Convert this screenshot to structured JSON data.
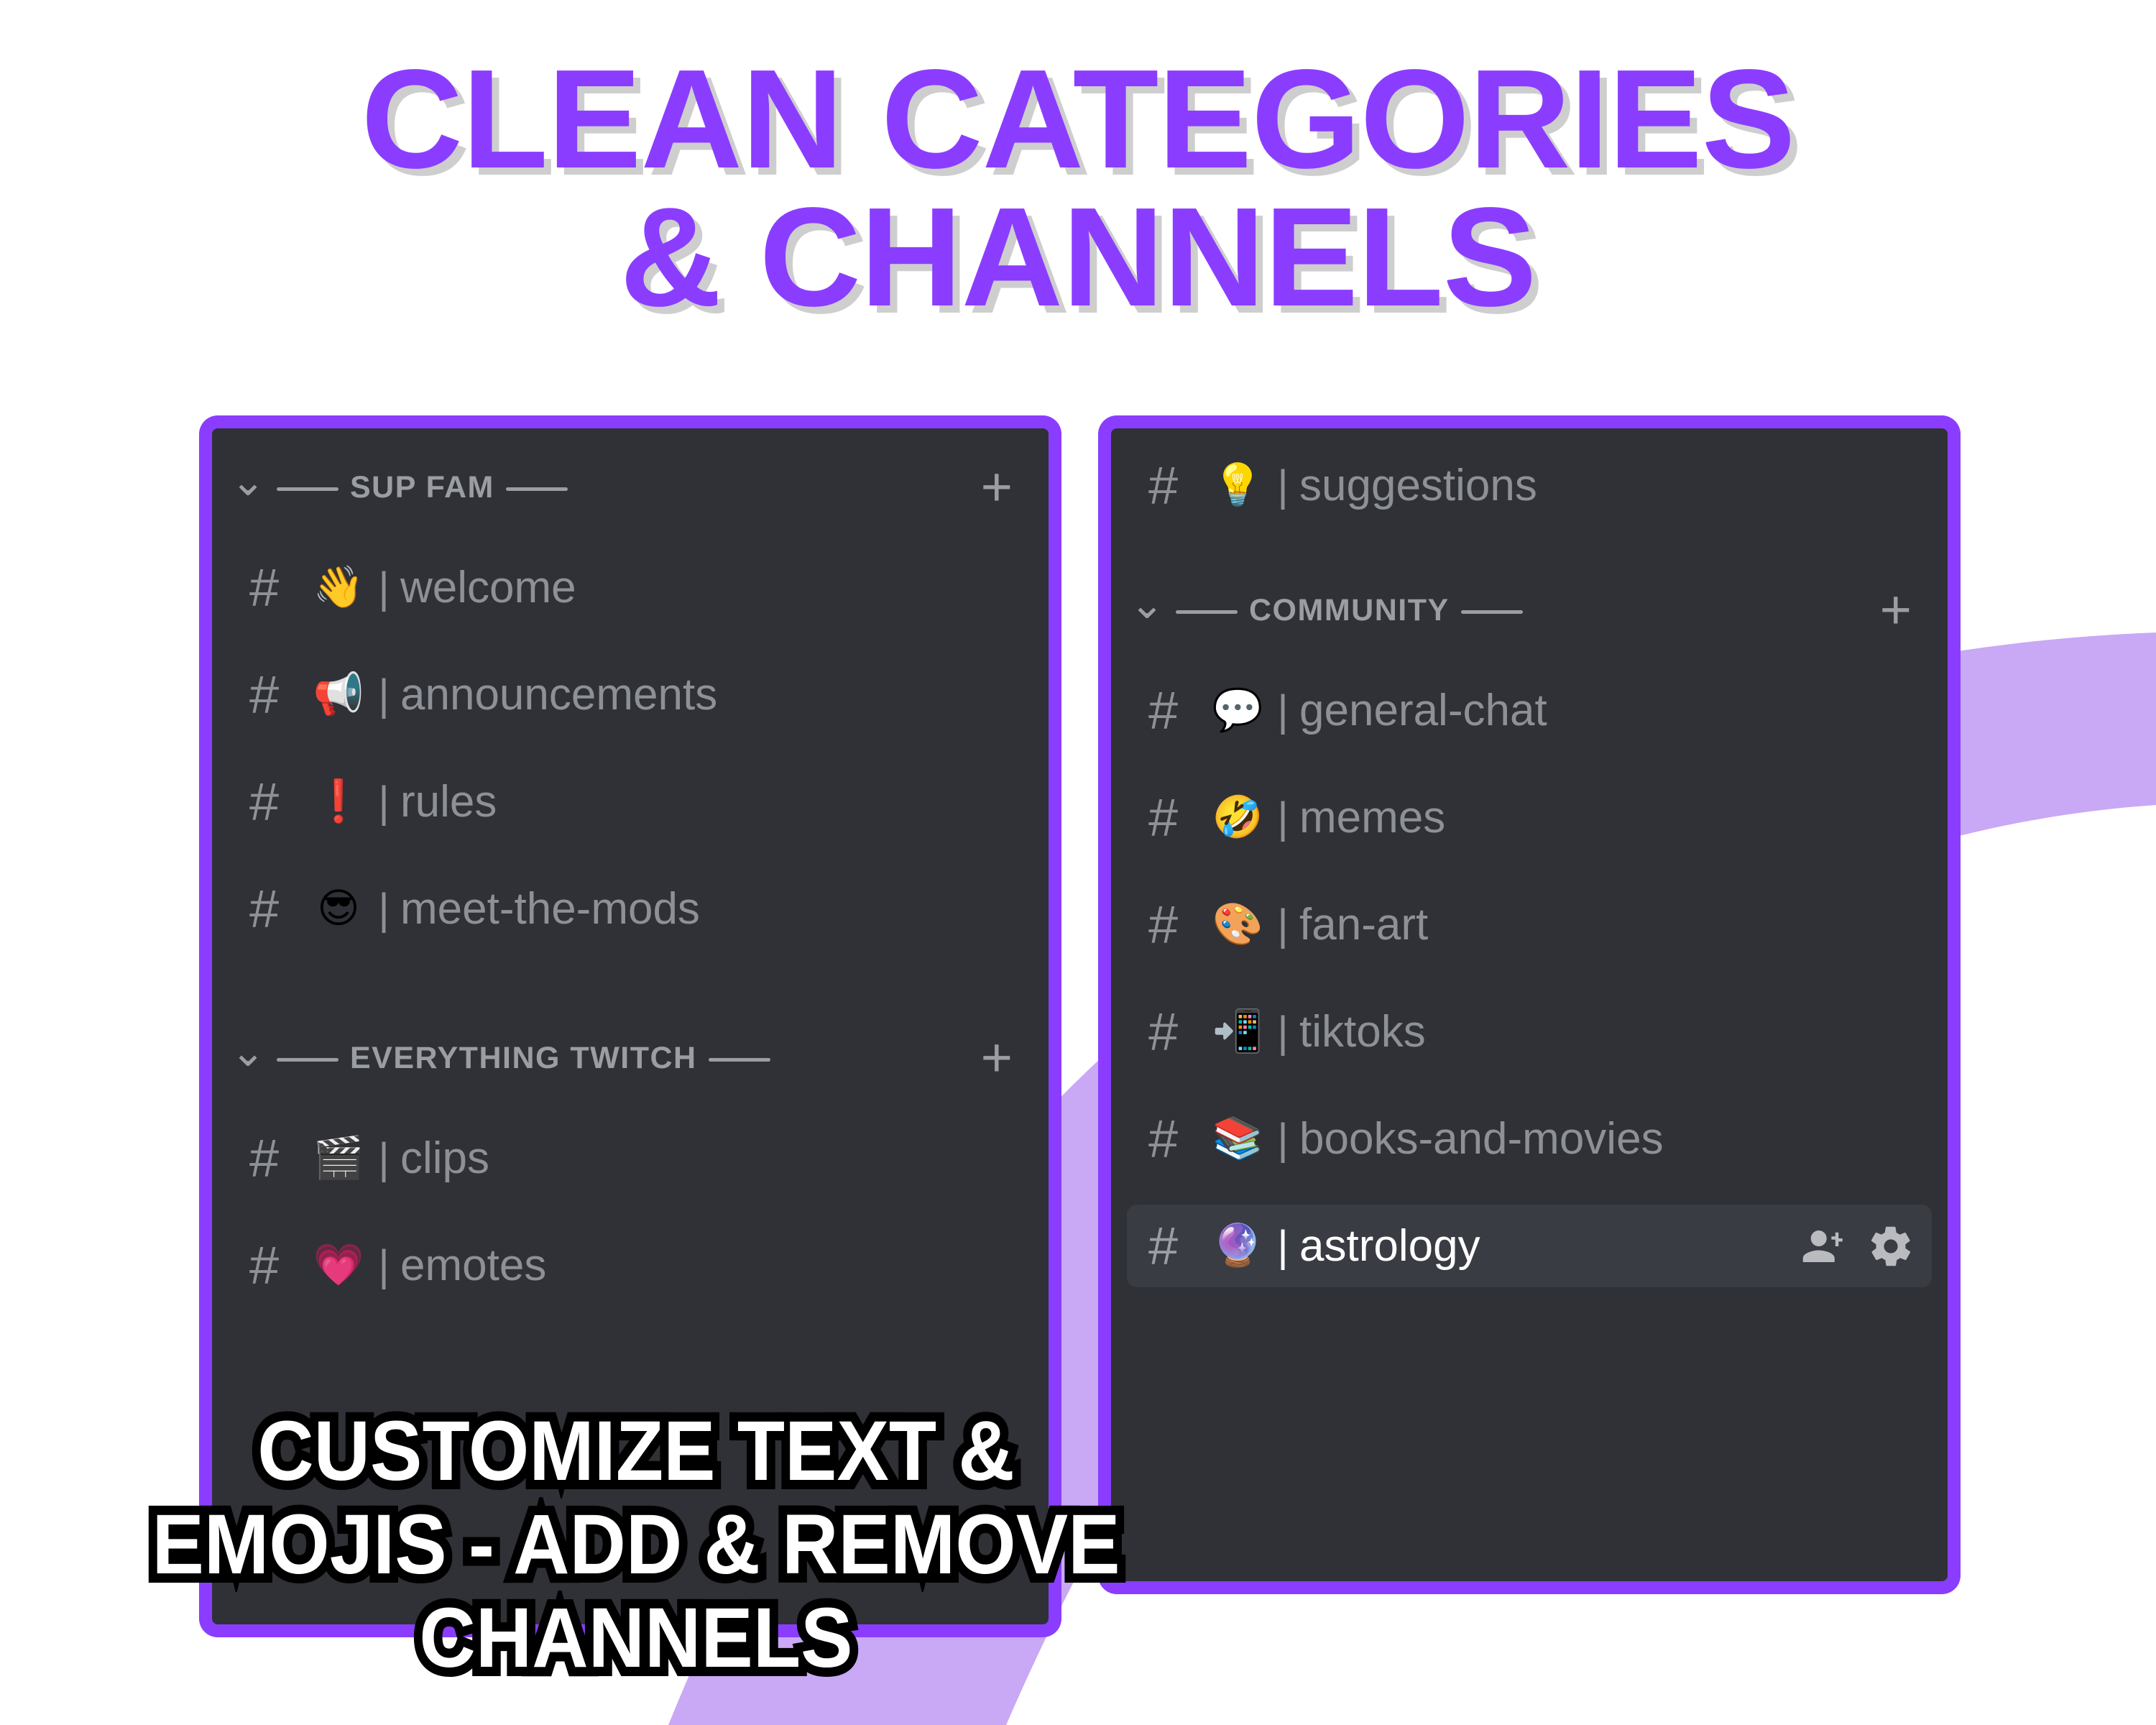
{
  "title": {
    "line1": "CLEAN CATEGORIES",
    "line2": "& CHANNELS",
    "color": "#8B3DFF",
    "shadow_color": "#BEBEBE"
  },
  "theme": {
    "page_background": "#FFFFFF",
    "panel_border": "#8B3DFF",
    "panel_background": "#2F3136",
    "active_row_background": "#3A3C43",
    "muted_text": "#8D9096",
    "category_text": "#9A9DA2",
    "active_text": "#FFFFFF",
    "swoosh": "#C9A8F5"
  },
  "left_panel": {
    "categories": [
      {
        "name": "SUP FAM",
        "collapse_icon": "chevron-down-icon",
        "add_icon": "plus-icon",
        "channels": [
          {
            "hash": "#",
            "emoji": "👋",
            "emoji_name": "waving-hand",
            "separator": "|",
            "name": "welcome",
            "active": false
          },
          {
            "hash": "#",
            "emoji": "📢",
            "emoji_name": "loudspeaker",
            "separator": "|",
            "name": "announcements",
            "active": false
          },
          {
            "hash": "#",
            "emoji": "❗",
            "emoji_name": "red-exclamation-mark",
            "separator": "|",
            "name": "rules",
            "active": false
          },
          {
            "hash": "#",
            "emoji": "😎",
            "emoji_name": "smiling-face-with-sunglasses",
            "separator": "|",
            "name": "meet-the-mods",
            "active": false
          }
        ]
      },
      {
        "name": "EVERYTHING TWITCH",
        "collapse_icon": "chevron-down-icon",
        "add_icon": "plus-icon",
        "channels": [
          {
            "hash": "#",
            "emoji": "🎬",
            "emoji_name": "clapper-board",
            "separator": "|",
            "name": "clips",
            "active": false
          },
          {
            "hash": "#",
            "emoji": "💗",
            "emoji_name": "growing-heart",
            "separator": "|",
            "name": "emotes",
            "active": false
          }
        ]
      }
    ]
  },
  "right_panel": {
    "top_channels": [
      {
        "hash": "#",
        "emoji": "💡",
        "emoji_name": "light-bulb",
        "separator": "|",
        "name": "suggestions",
        "active": false
      }
    ],
    "categories": [
      {
        "name": "COMMUNITY",
        "collapse_icon": "chevron-down-icon",
        "add_icon": "plus-icon",
        "channels": [
          {
            "hash": "#",
            "emoji": "💬",
            "emoji_name": "speech-balloon",
            "separator": "|",
            "name": "general-chat",
            "active": false
          },
          {
            "hash": "#",
            "emoji": "🤣",
            "emoji_name": "rolling-on-the-floor-laughing",
            "separator": "|",
            "name": "memes",
            "active": false
          },
          {
            "hash": "#",
            "emoji": "🎨",
            "emoji_name": "artist-palette",
            "separator": "|",
            "name": "fan-art",
            "active": false
          },
          {
            "hash": "#",
            "emoji": "📲",
            "emoji_name": "mobile-phone-with-arrow",
            "separator": "|",
            "name": "tiktoks",
            "active": false
          },
          {
            "hash": "#",
            "emoji": "📚",
            "emoji_name": "books",
            "separator": "|",
            "name": "books-and-movies",
            "active": false
          },
          {
            "hash": "#",
            "emoji": "🔮",
            "emoji_name": "crystal-ball",
            "separator": "|",
            "name": "astrology",
            "active": true,
            "actions": [
              "add-member-icon",
              "gear-icon"
            ]
          }
        ]
      }
    ]
  },
  "caption": {
    "line1": "CUSTOMIZE TEXT &",
    "line2": "EMOJIS - ADD & REMOVE",
    "line3": "CHANNELS"
  }
}
